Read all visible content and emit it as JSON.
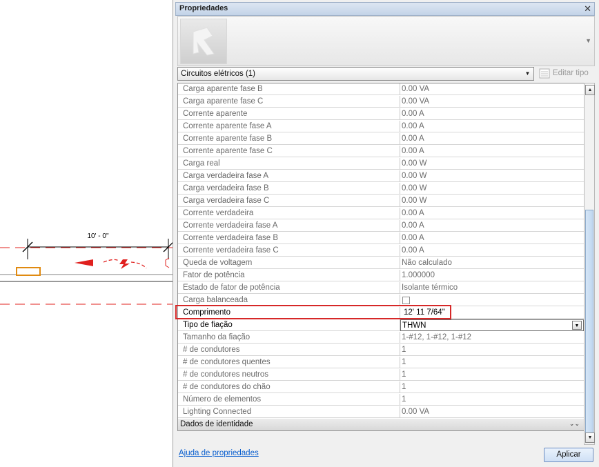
{
  "canvas": {
    "dimension_label": "10' - 0\""
  },
  "panel": {
    "title": "Propriedades",
    "close_glyph": "✕",
    "type_selector": "Circuitos elétricos (1)",
    "edit_type_label": "Editar tipo",
    "properties": [
      {
        "name": "Carga aparente fase B",
        "value": "0.00 VA"
      },
      {
        "name": "Carga aparente fase C",
        "value": "0.00 VA"
      },
      {
        "name": "Corrente aparente",
        "value": "0.00 A"
      },
      {
        "name": "Corrente aparente fase A",
        "value": "0.00 A"
      },
      {
        "name": "Corrente aparente fase B",
        "value": "0.00 A"
      },
      {
        "name": "Corrente aparente fase C",
        "value": "0.00 A"
      },
      {
        "name": "Carga real",
        "value": "0.00 W"
      },
      {
        "name": "Carga verdadeira fase A",
        "value": "0.00 W"
      },
      {
        "name": "Carga verdadeira fase B",
        "value": "0.00 W"
      },
      {
        "name": "Carga verdadeira fase C",
        "value": "0.00 W"
      },
      {
        "name": "Corrente verdadeira",
        "value": "0.00 A"
      },
      {
        "name": "Corrente verdadeira fase A",
        "value": "0.00 A"
      },
      {
        "name": "Corrente verdadeira fase B",
        "value": "0.00 A"
      },
      {
        "name": "Corrente verdadeira fase C",
        "value": "0.00 A"
      },
      {
        "name": "Queda de voltagem",
        "value": "Não calculado"
      },
      {
        "name": "Fator de potência",
        "value": "1.000000"
      },
      {
        "name": "Estado de fator de potência",
        "value": "Isolante térmico"
      },
      {
        "name": "Carga balanceada",
        "value": ""
      },
      {
        "name": "Comprimento",
        "value": "12'  11 7/64\""
      },
      {
        "name": "Tipo de fiação",
        "value": "THWN"
      },
      {
        "name": "Tamanho da fiação",
        "value": "1-#12, 1-#12, 1-#12"
      },
      {
        "name": "# de condutores",
        "value": "1"
      },
      {
        "name": "# de condutores quentes",
        "value": "1"
      },
      {
        "name": "# de condutores neutros",
        "value": "1"
      },
      {
        "name": "# de condutores do chão",
        "value": "1"
      },
      {
        "name": "Número de elementos",
        "value": "1"
      },
      {
        "name": "Lighting Connected",
        "value": "0.00 VA"
      }
    ],
    "group_label": "Dados de identidade",
    "help_link": "Ajuda de propriedades",
    "apply_button": "Aplicar",
    "highlight_color": "#d62828",
    "accent_red": "#e0201e",
    "element_orange": "#e08a10"
  }
}
